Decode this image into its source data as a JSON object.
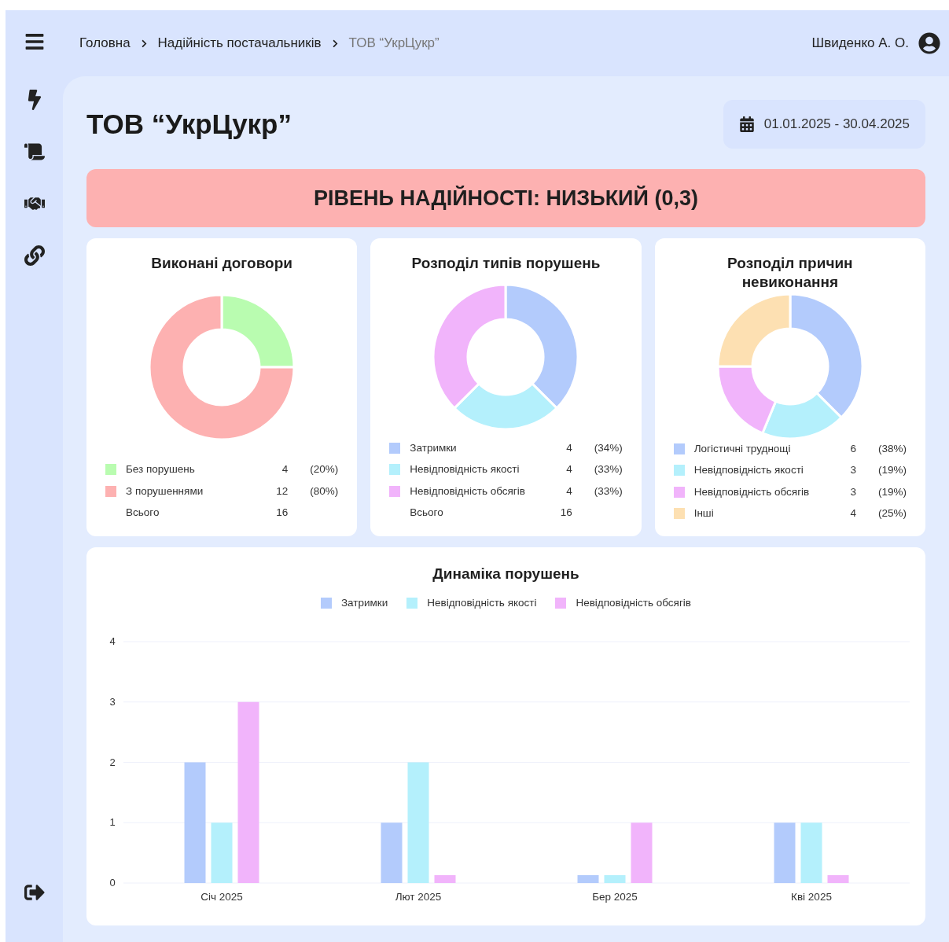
{
  "breadcrumb": [
    {
      "label": "Головна",
      "current": false
    },
    {
      "label": "Надійність постачальників",
      "current": false
    },
    {
      "label": "ТОВ “УкрЦукр”",
      "current": true
    }
  ],
  "user": {
    "name": "Швиденко А. О."
  },
  "page": {
    "title": "ТОВ “УкрЦукр”",
    "date_range": "01.01.2025 - 30.04.2025"
  },
  "reliability_banner": {
    "text": "РІВЕНЬ НАДІЙНОСТІ: НИЗЬКИЙ (0,3)"
  },
  "donut_cards": [
    {
      "title": "Виконані договори",
      "chart_data": {
        "type": "donut",
        "categories": [
          "Без порушень",
          "З порушеннями"
        ],
        "values": [
          25,
          75
        ]
      },
      "legend": [
        {
          "count": "4",
          "percent": "(20%)",
          "color": "#b9fcb0"
        },
        {
          "count": "12",
          "percent": "(80%)",
          "color": "#fdb1b1"
        }
      ],
      "total": {
        "label": "Всього",
        "count": "16"
      }
    },
    {
      "title": "Розподіл типів порушень",
      "chart_data": {
        "type": "donut",
        "categories": [
          "Затримки",
          "Невідповідність якості",
          "Невідповідність обсягів"
        ],
        "values": [
          37.5,
          25,
          37.5
        ]
      },
      "legend": [
        {
          "count": "4",
          "percent": "(34%)",
          "color": "#b3cbfc"
        },
        {
          "count": "4",
          "percent": "(33%)",
          "color": "#b4f0fc"
        },
        {
          "count": "4",
          "percent": "(33%)",
          "color": "#f1b4fb"
        }
      ],
      "total": {
        "label": "Всього",
        "count": "16"
      }
    },
    {
      "title": "Розподіл причин невиконання",
      "chart_data": {
        "type": "donut",
        "categories": [
          "Логістичні труднощі",
          "Невідповідність якості",
          "Невідповідність обсягів",
          "Інші"
        ],
        "values": [
          37.5,
          18.75,
          18.75,
          25
        ]
      },
      "legend": [
        {
          "count": "6",
          "percent": "(38%)",
          "color": "#b3cbfc"
        },
        {
          "count": "3",
          "percent": "(19%)",
          "color": "#b4f0fc"
        },
        {
          "count": "3",
          "percent": "(19%)",
          "color": "#f1b4fb"
        },
        {
          "count": "4",
          "percent": "(25%)",
          "color": "#fde0b2"
        }
      ]
    }
  ],
  "trend_chart": {
    "chart_data": {
      "type": "bar",
      "title": "Динаміка порушень",
      "grid": true,
      "legend": "top",
      "categories": [
        "Січ 2025",
        "Лют 2025",
        "Бер 2025",
        "Кві 2025"
      ],
      "ylim": [
        0,
        4
      ],
      "yticks": [
        0,
        1,
        2,
        3,
        4
      ],
      "series": [
        {
          "name": "Затримки",
          "color": "#b3cbfc",
          "values": [
            2,
            1,
            0.13,
            1
          ]
        },
        {
          "name": "Невідповідність якості",
          "color": "#b4f0fc",
          "values": [
            1,
            2,
            0.13,
            1
          ]
        },
        {
          "name": "Невідповідність обсягів",
          "color": "#f1b4fb",
          "values": [
            3,
            0.13,
            1,
            0.13
          ]
        }
      ]
    }
  }
}
